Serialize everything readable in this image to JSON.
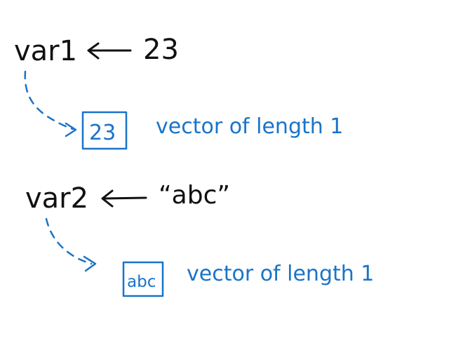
{
  "colors": {
    "ink": "#111111",
    "annotation": "#1a73c8",
    "background": "#ffffff"
  },
  "assignments": [
    {
      "variable": "var1",
      "value": "23",
      "box_content": "23",
      "description": "vector of length 1"
    },
    {
      "variable": "var2",
      "value": "“abc”",
      "box_content": "abc",
      "description": "vector of length 1"
    }
  ],
  "icons": {
    "assign_arrow": "left-arrow-icon",
    "pointer_arrow": "dashed-curved-arrow-icon"
  }
}
